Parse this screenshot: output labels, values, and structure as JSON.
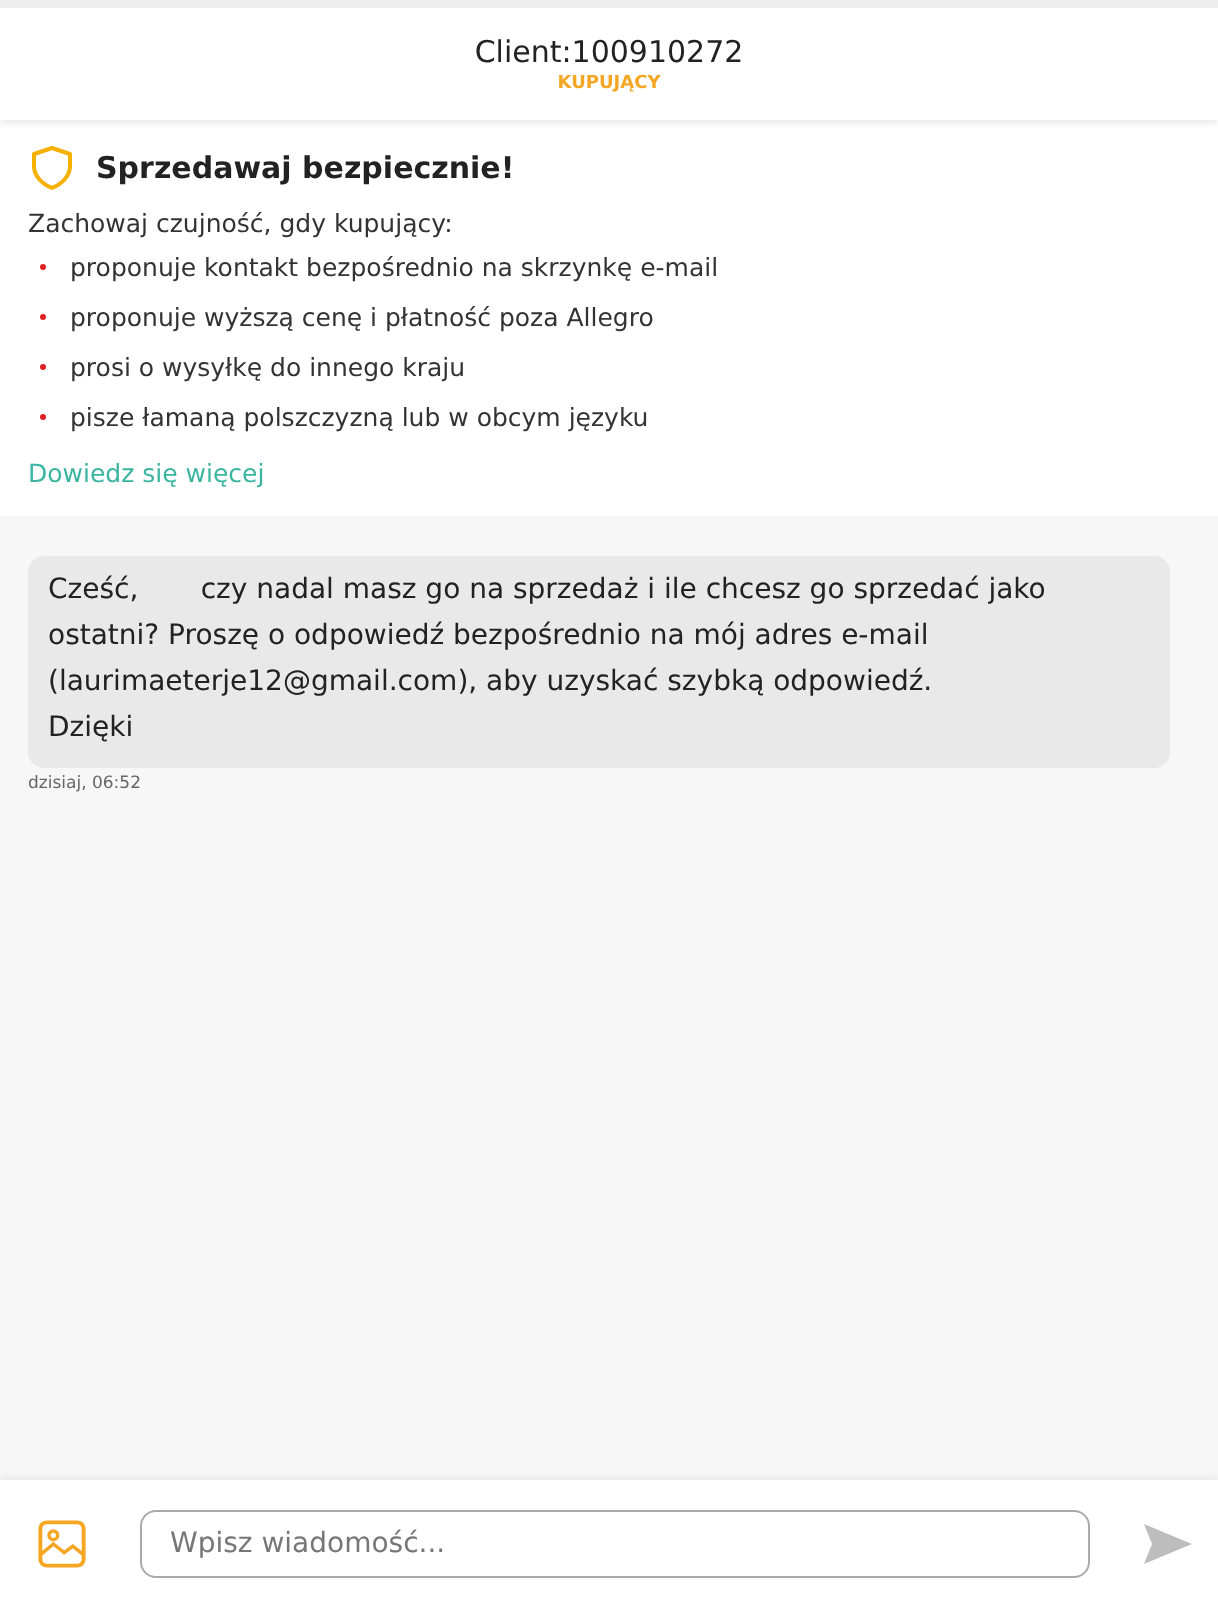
{
  "header": {
    "title": "Client:100910272",
    "role": "KUPUJĄCY"
  },
  "safety": {
    "title": "Sprzedawaj bezpiecznie!",
    "intro": "Zachowaj czujność, gdy kupujący:",
    "items": [
      "proponuje kontakt bezpośrednio na skrzynkę e-mail",
      "proponuje wyższą cenę i płatność poza Allegro",
      "prosi o wysyłkę do innego kraju",
      "pisze łamaną polszczyzną lub w obcym języku"
    ],
    "link": "Dowiedz się więcej"
  },
  "messages": [
    {
      "text": "Cześć,       czy nadal masz go na sprzedaż i ile chcesz go sprzedać jako ostatni? Proszę o odpowiedź bezpośrednio na mój adres e-mail (laurimaeterje12@gmail.com), aby uzyskać szybką odpowiedź.\nDzięki",
      "time": "dzisiaj, 06:52"
    }
  ],
  "composer": {
    "placeholder": "Wpisz wiadomość..."
  }
}
